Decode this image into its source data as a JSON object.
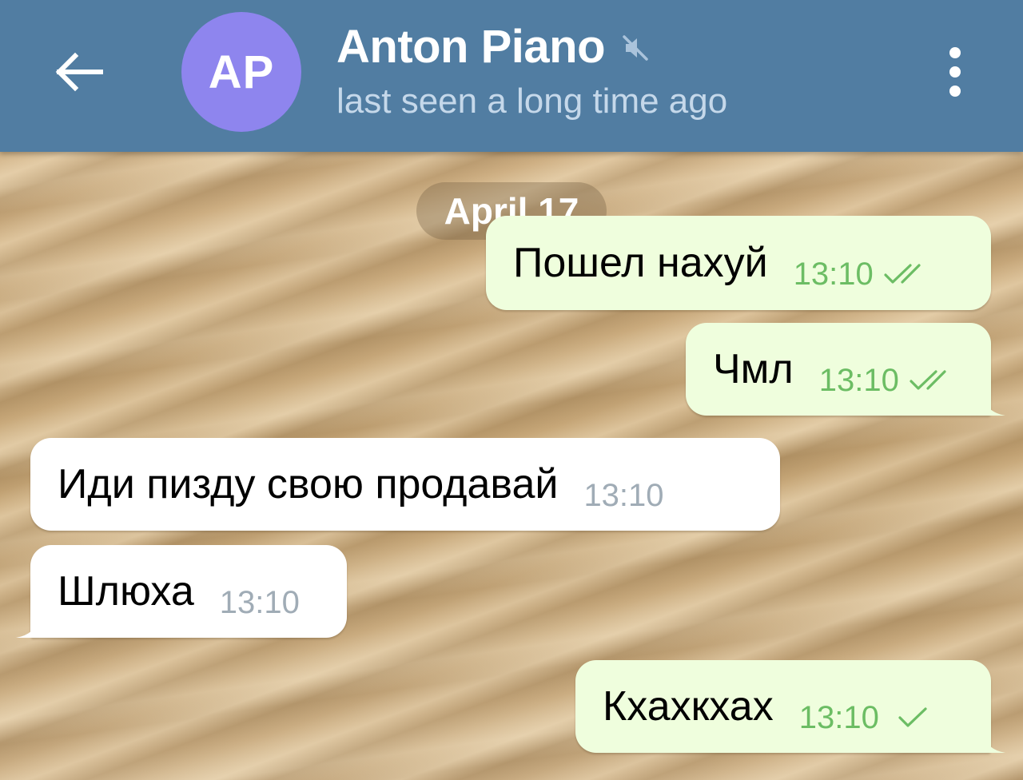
{
  "header": {
    "title": "Anton Piano",
    "status": "last seen a long time ago",
    "avatar_initials": "AP",
    "avatar_color": "#8e85ee",
    "bar_color": "#517da2",
    "icons": [
      "arrow-left-icon",
      "mute-icon",
      "more-vertical-icon"
    ]
  },
  "chat": {
    "date_label": "April 17",
    "messages": [
      {
        "direction": "outgoing",
        "text": "Пошел нахуй",
        "time": "13:10",
        "status": "read"
      },
      {
        "direction": "outgoing",
        "text": "Чмл",
        "time": "13:10",
        "status": "read"
      },
      {
        "direction": "incoming",
        "text": "Иди пизду свою продавай",
        "time": "13:10"
      },
      {
        "direction": "incoming",
        "text": "Шлюха",
        "time": "13:10"
      },
      {
        "direction": "outgoing",
        "text": "Кхахкхах",
        "time": "13:10",
        "status": "sent"
      }
    ],
    "colors": {
      "outgoing_bubble": "#effedd",
      "incoming_bubble": "#ffffff",
      "outgoing_time": "#6cbd64",
      "incoming_time": "#a0acb6"
    }
  }
}
